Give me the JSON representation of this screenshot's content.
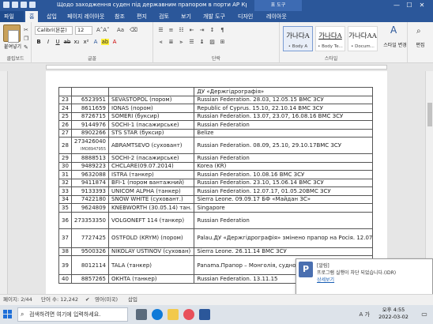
{
  "titlebar": {
    "title": "Щодо заходження суден під  державним прапором в порти АР Крим ...",
    "context_tab_group": "표 도구",
    "min": "—",
    "max": "☐",
    "close": "✕"
  },
  "tabs": [
    "파일",
    "홈",
    "삽입",
    "페이지 레이아웃",
    "참조",
    "편지",
    "검토",
    "보기",
    "개발 도구",
    "디자인",
    "레이아웃"
  ],
  "ribbon": {
    "paste_label": "붙여넣기",
    "clipboard_label": "클립보드",
    "font_name": "Calibri(본문)",
    "font_size": "12",
    "font_label": "글꼴",
    "paragraph_label": "단락",
    "styles_label": "스타일",
    "edit_label": "편집",
    "change_styles_label": "스타일 변경",
    "styles": [
      {
        "sample": "가나다A",
        "name": "• Body A"
      },
      {
        "sample": "가나다A",
        "name": "• Body Te..."
      },
      {
        "sample": "가나다AA",
        "name": "• Docum..."
      }
    ]
  },
  "document": {
    "header_cell": "ДУ «Держгідрографія»",
    "rows": [
      {
        "n": "23",
        "id": "6523951",
        "name": "SEVASTOPOL (пором)",
        "info": "Russian Federation. 28.03, 12.05.15 BMC ЗСУ"
      },
      {
        "n": "24",
        "id": "8611659",
        "name": "IONAS (пором)",
        "info": "Republic of Cyprus. 15.10, 22.10.14 BMC ЗСУ"
      },
      {
        "n": "25",
        "id": "8726715",
        "name": "SOMERI (буксир)",
        "info": "Russian Federation. 13.07, 23.07, 16.08.16 BMC ЗСУ"
      },
      {
        "n": "26",
        "id": "9144976",
        "name": "SOCHI-1 (пасажирське)",
        "info": "Russian Federation"
      },
      {
        "n": "27",
        "id": "8902266",
        "name": "STS STAR (буксир)",
        "info": "Belize"
      },
      {
        "n": "28",
        "id": "273426040",
        "id_note": "IMO8947955",
        "name": "ABRAMTSEVO (суховант)",
        "info": "Russian Federation. 08.09, 25.10, 29.10.17BMC ЗСУ"
      },
      {
        "n": "29",
        "id": "8888513",
        "name": "SOCHI-2 (пасажирське)",
        "info": "Russian Federation"
      },
      {
        "n": "30",
        "id": "9489223",
        "name": "CHCLARE(09.07.2014)",
        "info": "Korea (KR)"
      },
      {
        "n": "31",
        "id": "9632088",
        "name": "ISTRA (танкер)",
        "info": "Russian Federation. 10.08.16 BMC ЗСУ"
      },
      {
        "n": "32",
        "id": "9411874",
        "name": "BFI-1 (пором вантажний)",
        "info": "Russian Federation. 23.10, 15.06.14 BMC ЗСУ"
      },
      {
        "n": "33",
        "id": "9133393",
        "name": "UNICOM ALPHA (танкер)",
        "info": "Russian Federation. 12.07.17, 01.05.20BMC ЗСУ"
      },
      {
        "n": "34",
        "id": "7422180",
        "name": "SNOW WHITE (суховант.)",
        "info": "Sierra Leone. 09.09.17 БФ «Майдан ЗС»"
      },
      {
        "n": "35",
        "id": "9624809",
        "name": "KNEBWORTH (30.05.14) тан.",
        "info": "Singapore"
      },
      {
        "n": "36",
        "id": "273353350",
        "name": "VOLGONEFT 114 (танкер)",
        "info": "Russian Federation"
      },
      {
        "n": "37",
        "id": "7727425",
        "name": "OSTFOLD (KRYM) (пором)",
        "info": "Palau.ДУ «Держгідрографія» змінено прапор на Росія. 12.07.17 BMC ЗСУ06.10.16 (щоденно)"
      },
      {
        "n": "38",
        "id": "9500326",
        "name": "NIKOLAY USTINOV (сухован)",
        "info": "Sierra Leone. 26.11.14  BMC ЗСУ"
      },
      {
        "n": "39",
        "id": "8012114",
        "name": "TALA (танкер)",
        "info": "Panama.Прапор – Монголія, судновласник/оператор – Туреччина. 04.01.18БФ «Май..."
      },
      {
        "n": "40",
        "id": "8857265",
        "name": "OKHTA (танкер)",
        "info": "Russian Federation. 13.11.15"
      }
    ]
  },
  "toast": {
    "title": "[알림]",
    "message": "프로그램 실행이 차단 되었습니다.(IDR)",
    "link": "상세보기"
  },
  "statusbar": {
    "page": "페이지: 2/44",
    "words": "단어 수: 12,242",
    "language": "영어(미국)",
    "mode": "삽입"
  },
  "taskbar": {
    "search_placeholder": "검색하려면 여기에 입력하세요.",
    "time": "오후 4:55",
    "date": "2022-03-02",
    "lang": "A 가"
  }
}
